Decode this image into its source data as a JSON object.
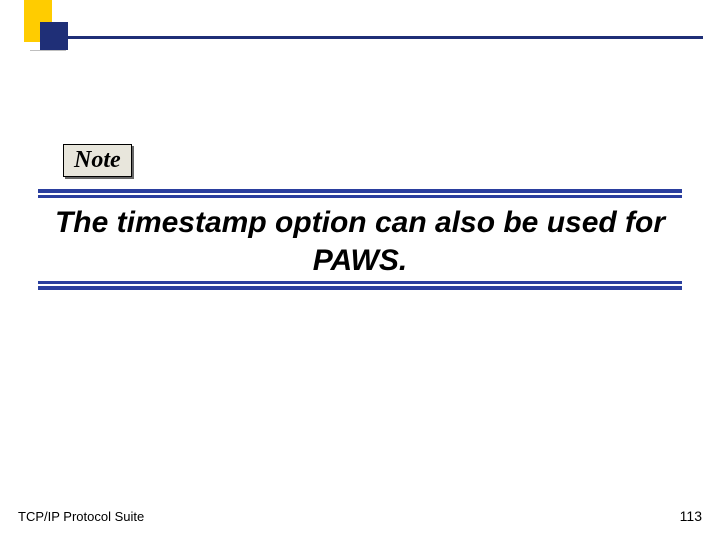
{
  "note_label": "Note",
  "body_text": "The timestamp option can also be used for PAWS.",
  "footer_left": "TCP/IP Protocol Suite",
  "page_number": "113",
  "colors": {
    "accent_yellow": "#ffcc00",
    "accent_navy": "#1f2f77",
    "band_blue": "#2a3e9e",
    "note_bg": "#e8e6dc"
  }
}
